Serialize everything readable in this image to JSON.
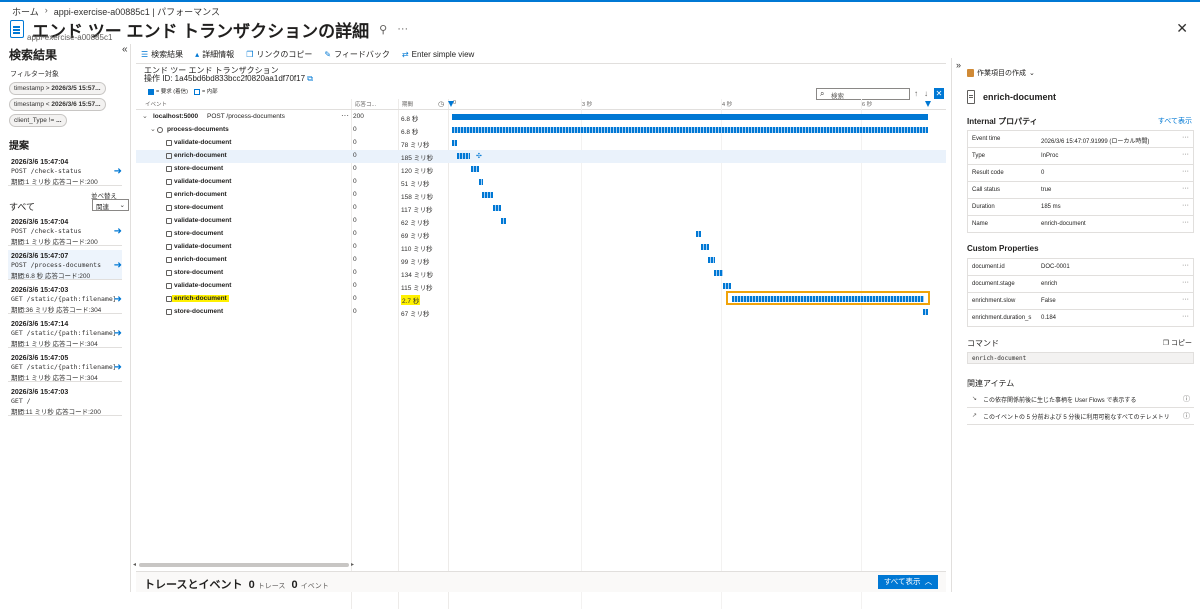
{
  "breadcrumb": [
    "ホーム",
    "appi-exercise-a00885c1 | パフォーマンス"
  ],
  "title": "エンド ツー エンド トランザクションの詳細",
  "subtitle": "appi-exercise-a00885c1",
  "left": {
    "heading": "検索結果",
    "filter_label": "フィルター対象",
    "filters": [
      {
        "key": "timestamp >",
        "value": "2026/3/5 15:57..."
      },
      {
        "key": "timestamp <",
        "value": "2026/3/6 15:57..."
      },
      {
        "key": "client_Type !=",
        "value": "..."
      }
    ],
    "suggest_title": "提案",
    "suggest": {
      "dt": "2026/3/6 15:47:04",
      "req": "POST /check-status",
      "meta": "期間:1 ミリ秒 応答コード:200"
    },
    "all_label": "すべて",
    "sort_label": "並べ替え",
    "sort_value": "関連",
    "results": [
      {
        "dt": "2026/3/6 15:47:04",
        "req": "POST /check-status",
        "meta": "期間:1 ミリ秒 応答コード:200"
      },
      {
        "dt": "2026/3/6 15:47:07",
        "req": "POST /process-documents",
        "meta": "期間:6.8 秒 応答コード:200"
      },
      {
        "dt": "2026/3/6 15:47:03",
        "req": "GET /static/{path:filename}",
        "meta": "期間:36 ミリ秒 応答コード:304"
      },
      {
        "dt": "2026/3/6 15:47:14",
        "req": "GET /static/{path:filename}",
        "meta": "期間:1 ミリ秒 応答コード:304"
      },
      {
        "dt": "2026/3/6 15:47:05",
        "req": "GET /static/{path:filename}",
        "meta": "期間:1 ミリ秒 応答コード:304"
      },
      {
        "dt": "2026/3/6 15:47:03",
        "req": "GET /",
        "meta": "期間:11 ミリ秒 応答コード:200"
      }
    ]
  },
  "toolbar": [
    "検索結果",
    "詳細情報",
    "リンクのコピー",
    "フィードバック",
    "Enter simple view"
  ],
  "transaction": {
    "title": "エンド ツー エンド トランザクション",
    "id_label": "操作 ID: 1a45bd6bd833bcc2f0820aa1df70f17"
  },
  "legend": {
    "external": "= 要求 (着信)",
    "internal": "= 内部"
  },
  "search_placeholder": "検索",
  "columns": {
    "event": "イベント",
    "code": "応答コ...",
    "duration": "期間"
  },
  "ticks": [
    "0",
    "3 秒",
    "4 秒",
    "6 秒"
  ],
  "rows": [
    {
      "name": "localhost:5000",
      "endpoint": "POST /process-documents",
      "code": "200",
      "duration": "6.8 秒"
    },
    {
      "name": "process-documents",
      "code": "0",
      "duration": "6.8 秒"
    },
    {
      "name": "validate-document",
      "code": "0",
      "duration": "78 ミリ秒"
    },
    {
      "name": "enrich-document",
      "code": "0",
      "duration": "185 ミリ秒"
    },
    {
      "name": "store-document",
      "code": "0",
      "duration": "120 ミリ秒"
    },
    {
      "name": "validate-document",
      "code": "0",
      "duration": "51 ミリ秒"
    },
    {
      "name": "enrich-document",
      "code": "0",
      "duration": "158 ミリ秒"
    },
    {
      "name": "store-document",
      "code": "0",
      "duration": "117 ミリ秒"
    },
    {
      "name": "validate-document",
      "code": "0",
      "duration": "62 ミリ秒"
    },
    {
      "name": "store-document",
      "code": "0",
      "duration": "69 ミリ秒"
    },
    {
      "name": "validate-document",
      "code": "0",
      "duration": "110 ミリ秒"
    },
    {
      "name": "enrich-document",
      "code": "0",
      "duration": "99 ミリ秒"
    },
    {
      "name": "store-document",
      "code": "0",
      "duration": "134 ミリ秒"
    },
    {
      "name": "validate-document",
      "code": "0",
      "duration": "115 ミリ秒"
    },
    {
      "name": "enrich-document",
      "code": "0",
      "duration": "2.7 秒"
    },
    {
      "name": "store-document",
      "code": "0",
      "duration": "67 ミリ秒"
    }
  ],
  "bottom": {
    "title": "トレースとイベント",
    "traces_count": "0",
    "traces_unit": "トレース",
    "events_count": "0",
    "events_unit": "イベント",
    "show_all": "すべて表示"
  },
  "right": {
    "work_item": "作業項目の作成",
    "title": "enrich-document",
    "internal_props": "Internal プロパティ",
    "show_all": "すべて表示",
    "props": [
      {
        "k": "Event time",
        "v": "2026/3/6 15:47:07.91999 (ローカル時間)"
      },
      {
        "k": "Type",
        "v": "InProc"
      },
      {
        "k": "Result code",
        "v": "0"
      },
      {
        "k": "Call status",
        "v": "true"
      },
      {
        "k": "Duration",
        "v": "185 ms"
      },
      {
        "k": "Name",
        "v": "enrich-document"
      }
    ],
    "custom_props": "Custom Properties",
    "custom": [
      {
        "k": "document.id",
        "v": "DOC-0001"
      },
      {
        "k": "document.stage",
        "v": "enrich"
      },
      {
        "k": "enrichment.slow",
        "v": "False"
      },
      {
        "k": "enrichment.duration_s",
        "v": "0.184"
      }
    ],
    "command_label": "コマンド",
    "copy_label": "コピー",
    "command_value": "enrich-document",
    "related_label": "関連アイテム",
    "related": [
      "この依存関係前後に生じた事柄を User Flows で表示する",
      "このイベントの 5 分前および 5 分後に利用可能なすべてのテレメトリ"
    ]
  },
  "colors": {
    "accent": "#0078d4",
    "highlight": "#fff100",
    "orange": "#f0a30a"
  }
}
